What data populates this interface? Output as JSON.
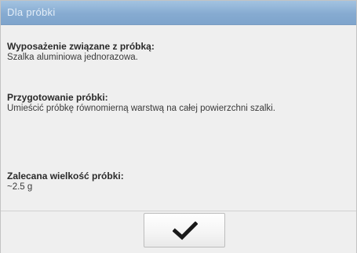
{
  "window": {
    "title": "Dla próbki"
  },
  "sections": [
    {
      "label": "Wyposażenie związane z próbką:",
      "value": "Szalka aluminiowa jednorazowa."
    },
    {
      "label": "Przygotowanie próbki:",
      "value": "Umieścić próbkę równomierną warstwą na całej powierzchni szalki."
    },
    {
      "label": "Zalecana wielkość próbki:",
      "value": "~2.5 g"
    }
  ],
  "footer": {
    "confirm_icon": "checkmark-icon"
  },
  "colors": {
    "titlebar": "#86abd1",
    "background": "#efefef",
    "check": "#1a1a1a"
  }
}
